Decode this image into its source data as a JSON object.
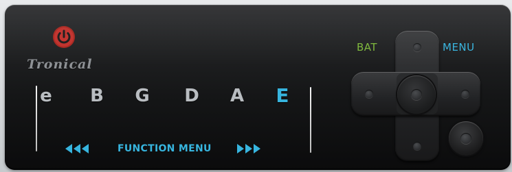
{
  "brand": {
    "name": "Tronical",
    "logo_icon": "power-icon",
    "logo_color": "#c0302b"
  },
  "tuning": {
    "strings": [
      {
        "note": "e",
        "active": false
      },
      {
        "note": "B",
        "active": false
      },
      {
        "note": "G",
        "active": false
      },
      {
        "note": "D",
        "active": false
      },
      {
        "note": "A",
        "active": false
      },
      {
        "note": "E",
        "active": true
      }
    ],
    "active_color": "#37b5df",
    "inactive_color": "#b9bdc1"
  },
  "function_menu": {
    "label": "FUNCTION MENU",
    "left_icon": "triple-left-arrow-icon",
    "right_icon": "triple-right-arrow-icon"
  },
  "controls": {
    "bat_label": "BAT",
    "bat_color": "#7db83a",
    "menu_label": "MENU",
    "menu_color": "#37b5df"
  }
}
